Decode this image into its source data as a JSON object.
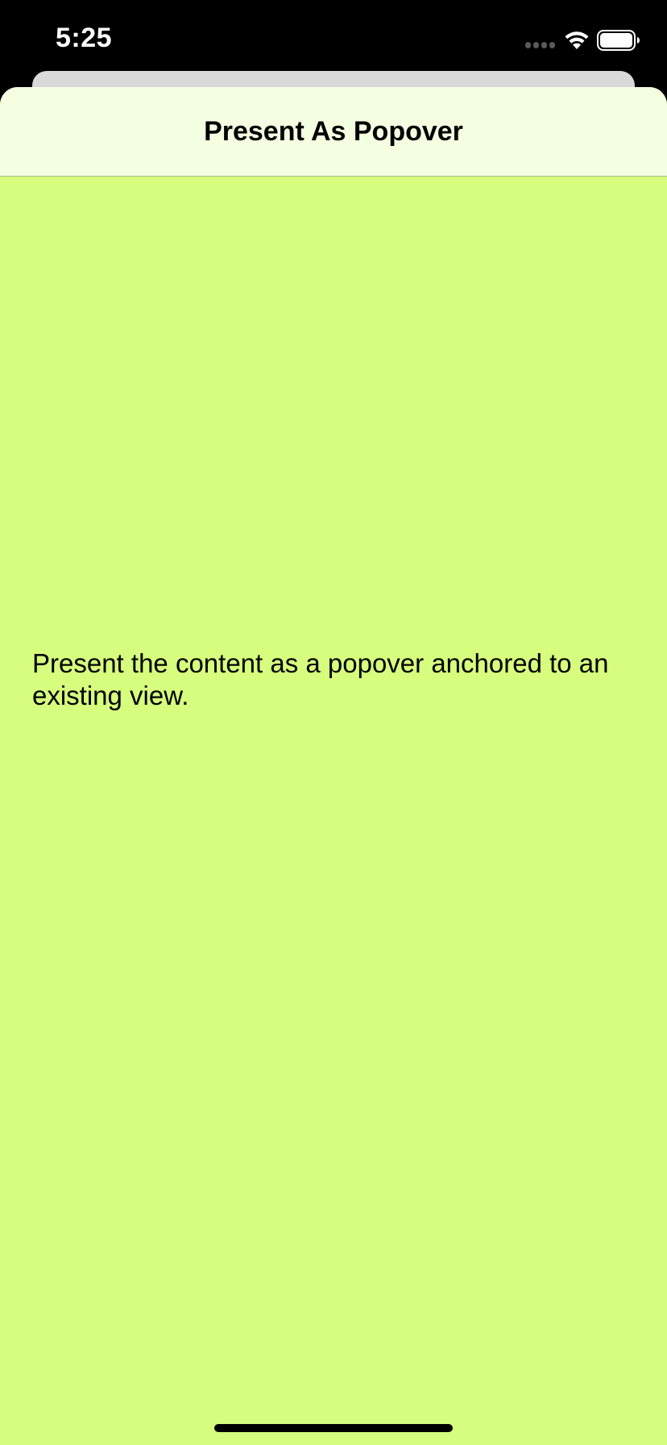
{
  "status_bar": {
    "time": "5:25",
    "icons": {
      "signal": "cellular-signal-icon",
      "wifi": "wifi-icon",
      "battery": "battery-icon"
    }
  },
  "sheet": {
    "title": "Present As Popover",
    "description": "Present the content as a popover anchored to an existing view."
  },
  "colors": {
    "sheet_background": "#d6fd7d",
    "nav_background": "#f4ffe1",
    "status_background": "#000000"
  }
}
